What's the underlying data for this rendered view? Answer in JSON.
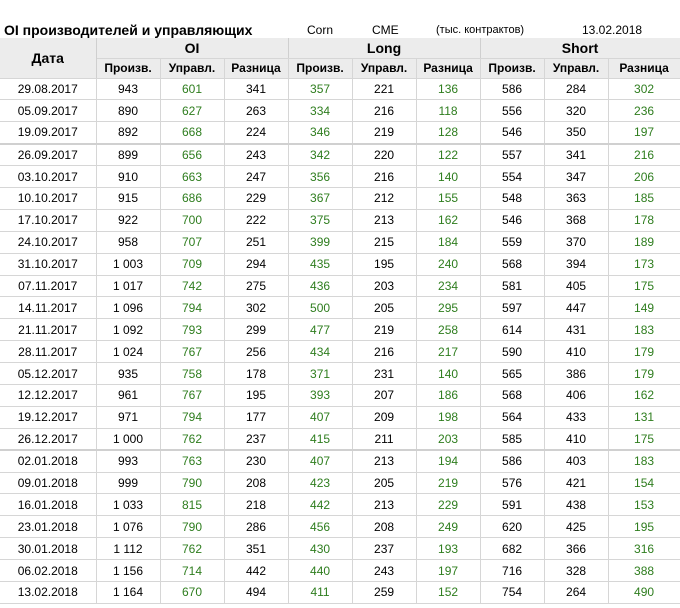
{
  "header": {
    "title": "OI производителей и управляющих",
    "symbol": "Corn",
    "exchange": "CME",
    "units": "(тыс. контрактов)",
    "date": "13.02.2018"
  },
  "columns": {
    "date": "Дата",
    "groups": [
      "OI",
      "Long",
      "Short"
    ],
    "sub": [
      "Произв.",
      "Управл.",
      "Разница"
    ]
  },
  "rows": [
    [
      "29.08.2017",
      "943",
      "601",
      "341",
      "357",
      "221",
      "136",
      "586",
      "284",
      "302"
    ],
    [
      "05.09.2017",
      "890",
      "627",
      "263",
      "334",
      "216",
      "118",
      "556",
      "320",
      "236"
    ],
    [
      "19.09.2017",
      "892",
      "668",
      "224",
      "346",
      "219",
      "128",
      "546",
      "350",
      "197"
    ],
    [
      "26.09.2017",
      "899",
      "656",
      "243",
      "342",
      "220",
      "122",
      "557",
      "341",
      "216"
    ],
    [
      "03.10.2017",
      "910",
      "663",
      "247",
      "356",
      "216",
      "140",
      "554",
      "347",
      "206"
    ],
    [
      "10.10.2017",
      "915",
      "686",
      "229",
      "367",
      "212",
      "155",
      "548",
      "363",
      "185"
    ],
    [
      "17.10.2017",
      "922",
      "700",
      "222",
      "375",
      "213",
      "162",
      "546",
      "368",
      "178"
    ],
    [
      "24.10.2017",
      "958",
      "707",
      "251",
      "399",
      "215",
      "184",
      "559",
      "370",
      "189"
    ],
    [
      "31.10.2017",
      "1 003",
      "709",
      "294",
      "435",
      "195",
      "240",
      "568",
      "394",
      "173"
    ],
    [
      "07.11.2017",
      "1 017",
      "742",
      "275",
      "436",
      "203",
      "234",
      "581",
      "405",
      "175"
    ],
    [
      "14.11.2017",
      "1 096",
      "794",
      "302",
      "500",
      "205",
      "295",
      "597",
      "447",
      "149"
    ],
    [
      "21.11.2017",
      "1 092",
      "793",
      "299",
      "477",
      "219",
      "258",
      "614",
      "431",
      "183"
    ],
    [
      "28.11.2017",
      "1 024",
      "767",
      "256",
      "434",
      "216",
      "217",
      "590",
      "410",
      "179"
    ],
    [
      "05.12.2017",
      "935",
      "758",
      "178",
      "371",
      "231",
      "140",
      "565",
      "386",
      "179"
    ],
    [
      "12.12.2017",
      "961",
      "767",
      "195",
      "393",
      "207",
      "186",
      "568",
      "406",
      "162"
    ],
    [
      "19.12.2017",
      "971",
      "794",
      "177",
      "407",
      "209",
      "198",
      "564",
      "433",
      "131"
    ],
    [
      "26.12.2017",
      "1 000",
      "762",
      "237",
      "415",
      "211",
      "203",
      "585",
      "410",
      "175"
    ],
    [
      "02.01.2018",
      "993",
      "763",
      "230",
      "407",
      "213",
      "194",
      "586",
      "403",
      "183"
    ],
    [
      "09.01.2018",
      "999",
      "790",
      "208",
      "423",
      "205",
      "219",
      "576",
      "421",
      "154"
    ],
    [
      "16.01.2018",
      "1 033",
      "815",
      "218",
      "442",
      "213",
      "229",
      "591",
      "438",
      "153"
    ],
    [
      "23.01.2018",
      "1 076",
      "790",
      "286",
      "456",
      "208",
      "249",
      "620",
      "425",
      "195"
    ],
    [
      "30.01.2018",
      "1 112",
      "762",
      "351",
      "430",
      "237",
      "193",
      "682",
      "366",
      "316"
    ],
    [
      "06.02.2018",
      "1 156",
      "714",
      "442",
      "440",
      "243",
      "197",
      "716",
      "328",
      "388"
    ],
    [
      "13.02.2018",
      "1 164",
      "670",
      "494",
      "411",
      "259",
      "152",
      "754",
      "264",
      "490"
    ]
  ],
  "colors": {
    "green_value": "#2e7d1e",
    "header_bg": "#ececec",
    "grid": "#d6d6d6"
  }
}
